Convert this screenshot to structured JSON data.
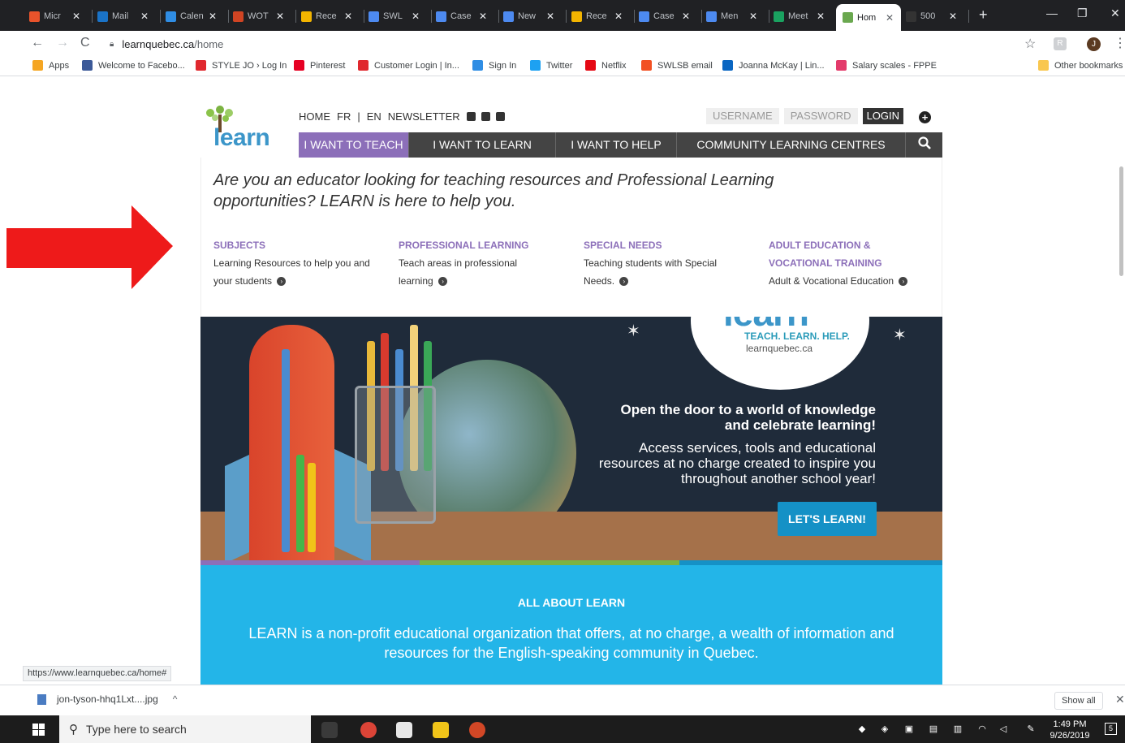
{
  "browser": {
    "tabs": [
      {
        "label": "Micr",
        "color": "#e8532b"
      },
      {
        "label": "Mail",
        "color": "#1a73c7"
      },
      {
        "label": "Calen",
        "color": "#2f8de4"
      },
      {
        "label": "WOT",
        "color": "#d04423"
      },
      {
        "label": "Rece",
        "color": "#f3b400"
      },
      {
        "label": "SWL",
        "color": "#4d8af0"
      },
      {
        "label": "Case",
        "color": "#4d8af0"
      },
      {
        "label": "New",
        "color": "#4d8af0"
      },
      {
        "label": "Rece",
        "color": "#f3b400"
      },
      {
        "label": "Case",
        "color": "#4d8af0"
      },
      {
        "label": "Men",
        "color": "#4d8af0"
      },
      {
        "label": "Meet",
        "color": "#1aa260"
      },
      {
        "label": "Hom",
        "color": "#6aa84f"
      },
      {
        "label": "500",
        "color": "#333333"
      }
    ],
    "new_tab": "+",
    "window": {
      "minimize": "—",
      "restore": "❐",
      "close": "✕"
    },
    "url_host": "learnquebec.ca",
    "url_path": "/home",
    "profile_initial": "J",
    "ext_initial": "R",
    "bookmarks": [
      {
        "label": "Apps",
        "color": "#f5a623"
      },
      {
        "label": "Welcome to Facebo...",
        "color": "#3b5998"
      },
      {
        "label": "STYLE JO › Log In",
        "color": "#e0282e"
      },
      {
        "label": "Pinterest",
        "color": "#e60023"
      },
      {
        "label": "Customer Login | In...",
        "color": "#e0282e"
      },
      {
        "label": "Sign In",
        "color": "#2f8de4"
      },
      {
        "label": "Twitter",
        "color": "#1da1f2"
      },
      {
        "label": "Netflix",
        "color": "#e50914"
      },
      {
        "label": "SWLSB email",
        "color": "#f25022"
      },
      {
        "label": "Joanna McKay | Lin...",
        "color": "#0a66c2"
      },
      {
        "label": "Salary scales - FPPE",
        "color": "#e33b6b"
      }
    ],
    "other_bookmarks": "Other bookmarks",
    "status_url": "https://www.learnquebec.ca/home#"
  },
  "site": {
    "logo_text": "learn",
    "top_links": [
      "HOME",
      "FR",
      "|",
      "EN",
      "NEWSLETTER"
    ],
    "username_placeholder": "USERNAME",
    "password_placeholder": "PASSWORD",
    "login_label": "LOGIN",
    "plus": "+",
    "nav": [
      "I WANT TO TEACH",
      "I WANT TO LEARN",
      "I WANT TO HELP",
      "COMMUNITY LEARNING CENTRES"
    ],
    "lead": "Are you an educator looking for teaching resources and Professional Learning opportunities? LEARN is here to help you.",
    "columns": [
      {
        "heading": "SUBJECTS",
        "desc": "Learning Resources to help you and your students"
      },
      {
        "heading": "PROFESSIONAL LEARNING",
        "desc": "Teach areas in professional learning"
      },
      {
        "heading": "SPECIAL NEEDS",
        "desc": "Teaching students with Special Needs."
      },
      {
        "heading": "ADULT EDUCATION & VOCATIONAL TRAINING",
        "desc": "Adult & Vocational Education"
      }
    ],
    "hero": {
      "badge_word": "learn",
      "tagline": "TEACH. LEARN. HELP.",
      "url": "learnquebec.ca",
      "headline": "Open the door to a world of knowledge and celebrate learning!",
      "body": "Access services, tools and educational resources at no charge created to inspire you throughout another school year!",
      "cta": "LET'S LEARN!"
    },
    "about": {
      "heading": "ALL ABOUT LEARN",
      "text": "LEARN is a non-profit educational organization that offers, at no charge, a wealth of information and resources for the English-speaking community in Quebec."
    }
  },
  "downloads": {
    "file": "jon-tyson-hhq1Lxt....jpg",
    "caret": "^",
    "show_all": "Show all",
    "close": "✕"
  },
  "taskbar": {
    "search_placeholder": "Type here to search",
    "time": "1:49 PM",
    "date": "9/26/2019",
    "notifications": "5"
  }
}
